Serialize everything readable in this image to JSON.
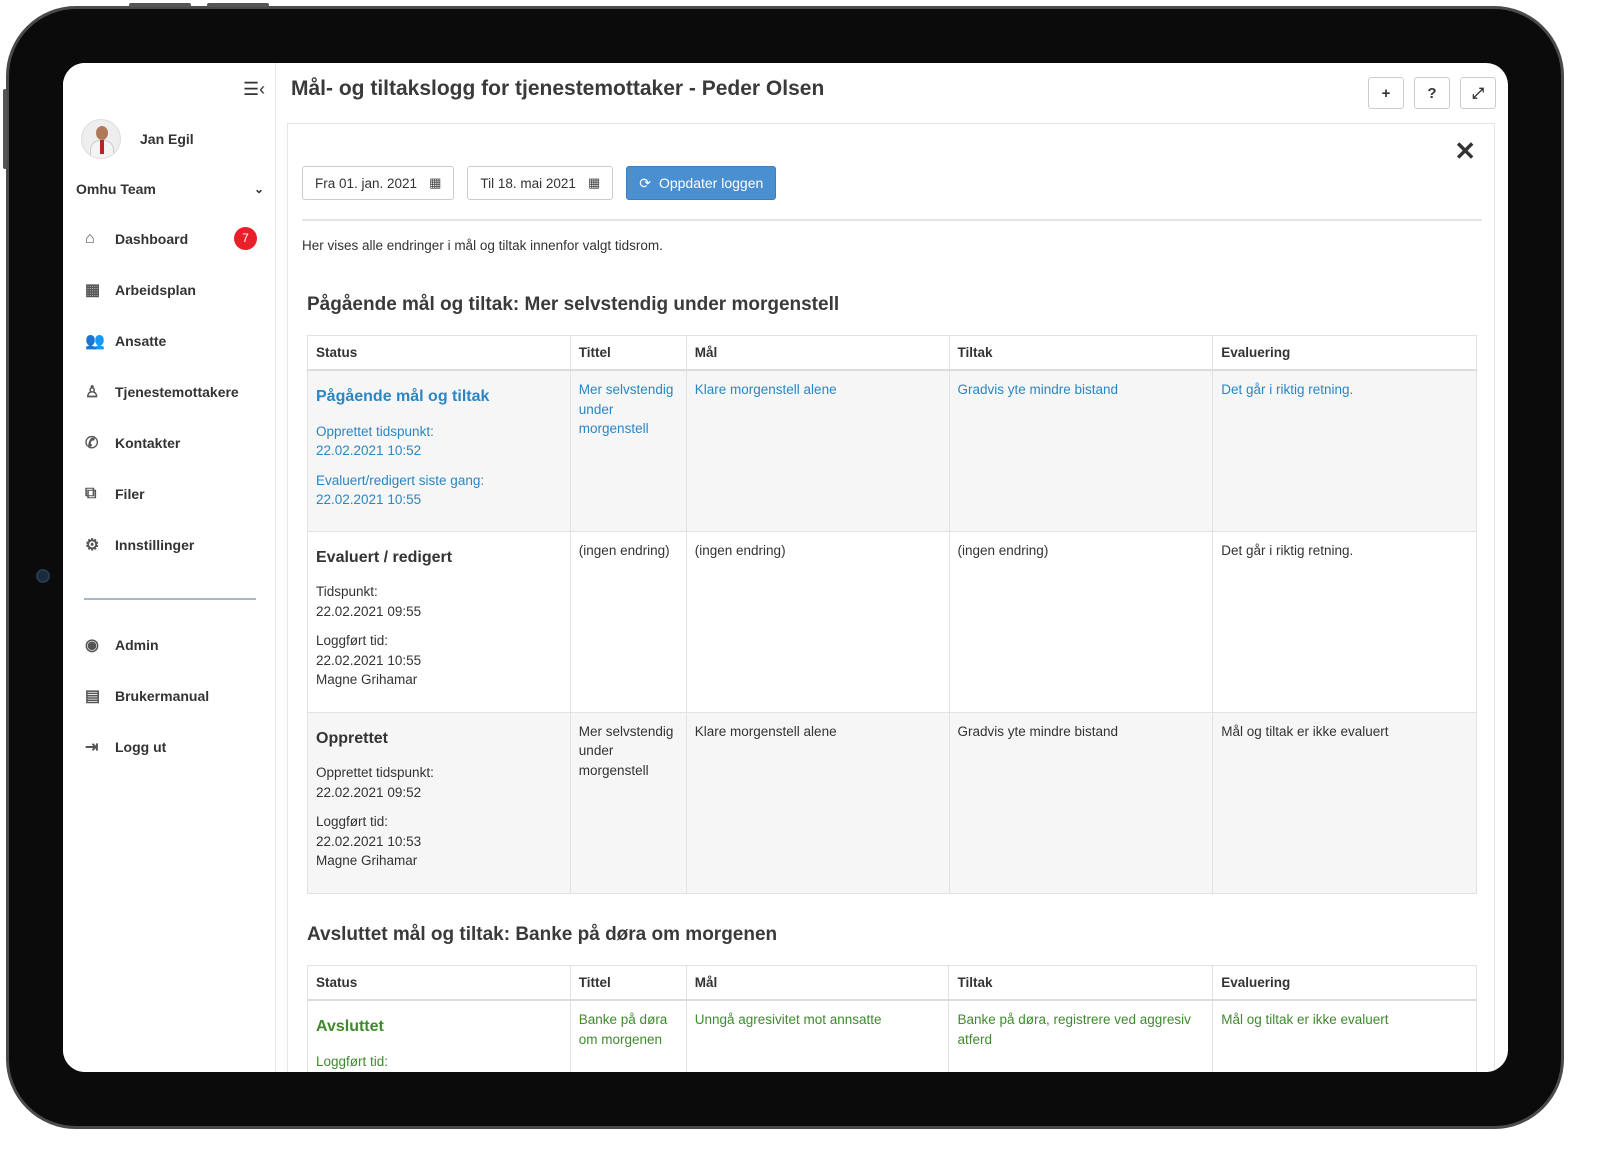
{
  "app": {
    "page_title": "Mål- og tiltakslogg for tjenestemottaker - Peder Olsen",
    "top_buttons": [
      "+",
      "?",
      "⤢"
    ]
  },
  "sidebar": {
    "user_name": "Jan Egil",
    "team": "Omhu Team",
    "items": [
      {
        "label": "Dashboard",
        "icon": "home-icon",
        "glyph": "⌂",
        "badge": "7"
      },
      {
        "label": "Arbeidsplan",
        "icon": "calendar-icon",
        "glyph": "▦"
      },
      {
        "label": "Ansatte",
        "icon": "users-icon",
        "glyph": "👥"
      },
      {
        "label": "Tjenestemottakere",
        "icon": "user-icon",
        "glyph": "♙"
      },
      {
        "label": "Kontakter",
        "icon": "phone-icon",
        "glyph": "✆"
      },
      {
        "label": "Filer",
        "icon": "files-icon",
        "glyph": "⧉"
      },
      {
        "label": "Innstillinger",
        "icon": "gear-icon",
        "glyph": "⚙"
      }
    ],
    "items2": [
      {
        "label": "Admin",
        "icon": "user-circle-icon",
        "glyph": "◉"
      },
      {
        "label": "Brukermanual",
        "icon": "document-icon",
        "glyph": "▤"
      },
      {
        "label": "Logg ut",
        "icon": "logout-icon",
        "glyph": "⇥"
      }
    ]
  },
  "filters": {
    "from": "Fra 01. jan. 2021",
    "to": "Til 18. mai 2021",
    "update_label": "Oppdater loggen"
  },
  "info_text": "Her vises alle endringer i mål og tiltak innenfor valgt tidsrom.",
  "section1": {
    "title": "Pågående mål og tiltak: Mer selvstendig under morgenstell",
    "headers": [
      "Status",
      "Tittel",
      "Mål",
      "Tiltak",
      "Evaluering"
    ],
    "rows": [
      {
        "status_title": "Pågående mål og tiltak",
        "status_lines": [
          [
            "Opprettet tidspunkt:",
            "22.02.2021 10:52"
          ],
          [
            "Evaluert/redigert siste gang:",
            "22.02.2021 10:55"
          ]
        ],
        "tittel": "Mer selvstendig under morgenstell",
        "maal": "Klare morgenstell alene",
        "tiltak": "Gradvis yte mindre bistand",
        "evaluering": "Det går i riktig retning."
      },
      {
        "status_title": "Evaluert / redigert",
        "status_lines": [
          [
            "Tidspunkt:",
            "22.02.2021 09:55"
          ],
          [
            "Loggført tid:",
            "22.02.2021 10:55",
            "Magne Grihamar"
          ]
        ],
        "tittel": "(ingen endring)",
        "maal": "(ingen endring)",
        "tiltak": "(ingen endring)",
        "evaluering": "Det går i riktig retning."
      },
      {
        "status_title": "Opprettet",
        "status_lines": [
          [
            "Opprettet tidspunkt:",
            "22.02.2021 09:52"
          ],
          [
            "Loggført tid:",
            "22.02.2021 10:53",
            "Magne Grihamar"
          ]
        ],
        "tittel": "Mer selvstendig under morgenstell",
        "maal": "Klare morgenstell alene",
        "tiltak": "Gradvis yte mindre bistand",
        "evaluering": "Mål og tiltak er ikke evaluert"
      }
    ]
  },
  "section2": {
    "title": "Avsluttet mål og tiltak: Banke på døra om morgenen",
    "headers": [
      "Status",
      "Tittel",
      "Mål",
      "Tiltak",
      "Evaluering"
    ],
    "rows": [
      {
        "status_title": "Avsluttet",
        "status_lines": [
          [
            "Loggført tid:"
          ]
        ],
        "tittel": "Banke på døra om morgenen",
        "maal": "Unngå agresivitet mot annsatte",
        "tiltak": "Banke på døra, registrere ved aggresiv atferd",
        "evaluering": "Mål og tiltak er ikke evaluert"
      }
    ]
  },
  "colors": {
    "link_blue": "#2a86c4",
    "closed_green": "#3f8a2e",
    "primary_button": "#4a8fd0",
    "badge_red": "#e8202a"
  }
}
